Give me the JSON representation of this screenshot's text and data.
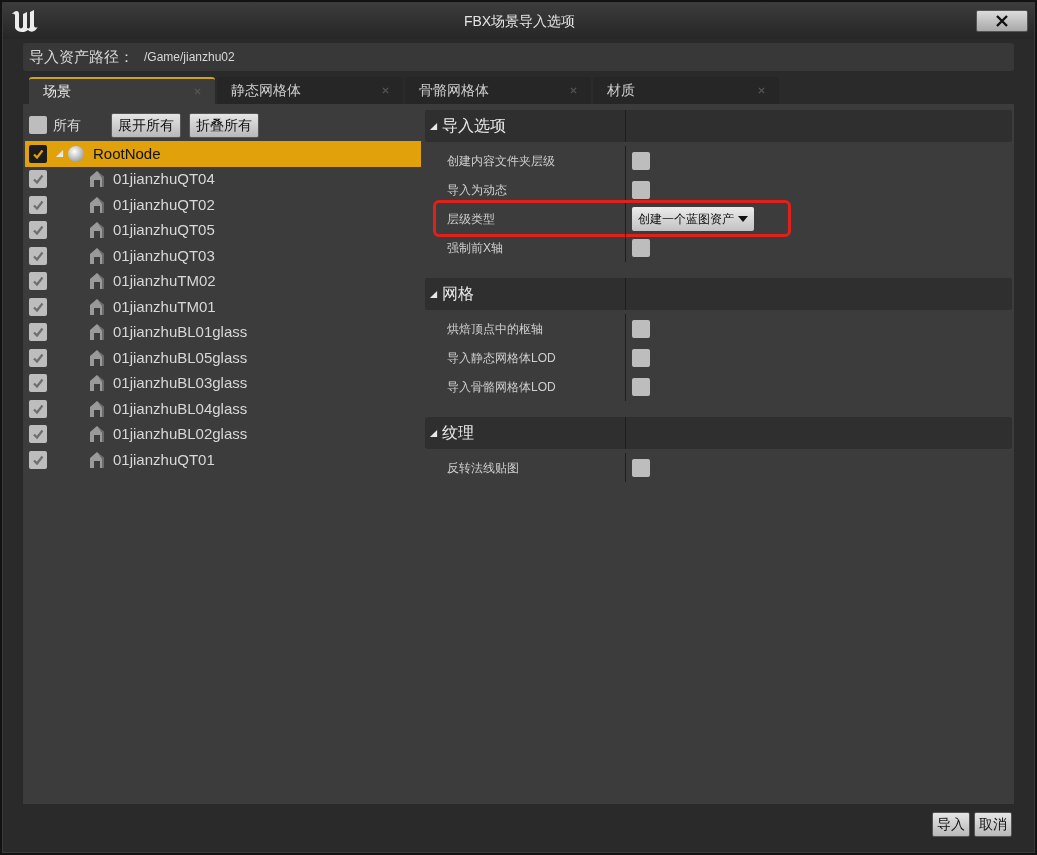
{
  "window": {
    "title": "FBX场景导入选项"
  },
  "path": {
    "label": "导入资产路径：",
    "value": "/Game/jianzhu02"
  },
  "tabs": [
    {
      "label": "场景",
      "selected": true
    },
    {
      "label": "静态网格体",
      "selected": false
    },
    {
      "label": "骨骼网格体",
      "selected": false
    },
    {
      "label": "材质",
      "selected": false
    }
  ],
  "scene": {
    "select_all": {
      "label": "所有",
      "checked": false
    },
    "buttons": [
      "展开所有",
      "折叠所有"
    ],
    "tree": [
      {
        "label": "RootNode",
        "kind": "root",
        "checked": true,
        "selected": true,
        "expanded": true,
        "children": [
          {
            "label": "01jianzhuQT04",
            "kind": "mesh",
            "checked": true,
            "selected": false
          },
          {
            "label": "01jianzhuQT02",
            "kind": "mesh",
            "checked": true,
            "selected": false
          },
          {
            "label": "01jianzhuQT05",
            "kind": "mesh",
            "checked": true,
            "selected": false
          },
          {
            "label": "01jianzhuQT03",
            "kind": "mesh",
            "checked": true,
            "selected": false
          },
          {
            "label": "01jianzhuTM02",
            "kind": "mesh",
            "checked": true,
            "selected": false
          },
          {
            "label": "01jianzhuTM01",
            "kind": "mesh",
            "checked": true,
            "selected": false
          },
          {
            "label": "01jianzhuBL01glass",
            "kind": "mesh",
            "checked": true,
            "selected": false
          },
          {
            "label": "01jianzhuBL05glass",
            "kind": "mesh",
            "checked": true,
            "selected": false
          },
          {
            "label": "01jianzhuBL03glass",
            "kind": "mesh",
            "checked": true,
            "selected": false
          },
          {
            "label": "01jianzhuBL04glass",
            "kind": "mesh",
            "checked": true,
            "selected": false
          },
          {
            "label": "01jianzhuBL02glass",
            "kind": "mesh",
            "checked": true,
            "selected": false
          },
          {
            "label": "01jianzhuQT01",
            "kind": "mesh",
            "checked": true,
            "selected": false
          }
        ]
      }
    ]
  },
  "details": {
    "sections": [
      {
        "title": "导入选项",
        "expanded": true,
        "options": [
          {
            "label": "创建内容文件夹层级",
            "kind": "checkbox",
            "checked": false,
            "highlighted": false
          },
          {
            "label": "导入为动态",
            "kind": "checkbox",
            "checked": false,
            "highlighted": false
          },
          {
            "label": "层级类型",
            "kind": "dropdown",
            "value": "创建一个蓝图资产",
            "highlighted": true
          },
          {
            "label": "强制前X轴",
            "kind": "checkbox",
            "checked": false,
            "highlighted": false
          }
        ]
      },
      {
        "title": "网格",
        "expanded": true,
        "options": [
          {
            "label": "烘焙顶点中的枢轴",
            "kind": "checkbox",
            "checked": false,
            "highlighted": false
          },
          {
            "label": "导入静态网格体LOD",
            "kind": "checkbox",
            "checked": false,
            "highlighted": false
          },
          {
            "label": "导入骨骼网格体LOD",
            "kind": "checkbox",
            "checked": false,
            "highlighted": false
          }
        ]
      },
      {
        "title": "纹理",
        "expanded": true,
        "options": [
          {
            "label": "反转法线贴图",
            "kind": "checkbox",
            "checked": false,
            "highlighted": false
          }
        ]
      }
    ]
  },
  "buttons": [
    "导入",
    "取消"
  ]
}
